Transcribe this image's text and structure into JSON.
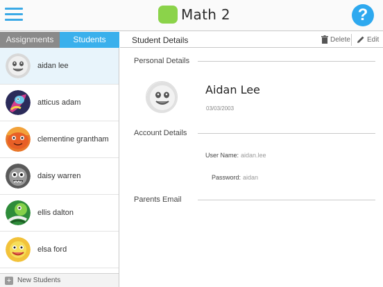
{
  "header": {
    "class_title": "Math 2",
    "badge_color": "#8bd34a",
    "help_label": "?",
    "accent": "#3aa9e6"
  },
  "tabs": [
    {
      "label": "Assignments",
      "active": false
    },
    {
      "label": "Students",
      "active": true
    }
  ],
  "students": [
    {
      "name": "aidan lee",
      "selected": true
    },
    {
      "name": "atticus adam",
      "selected": false
    },
    {
      "name": "clementine grantham",
      "selected": false
    },
    {
      "name": "daisy warren",
      "selected": false
    },
    {
      "name": "ellis dalton",
      "selected": false
    },
    {
      "name": "elsa ford",
      "selected": false
    }
  ],
  "sidebar_footer": {
    "plus": "+",
    "label": "New Students"
  },
  "detail": {
    "title": "Student Details",
    "delete_label": "Delete",
    "edit_label": "Edit",
    "personal_heading": "Personal Details",
    "student_name": "Aidan Lee",
    "date": "03/03/2003",
    "account_heading": "Account Details",
    "username_label": "User Name:",
    "username_value": "aidan.lee",
    "password_label": "Password:",
    "password_value": "aidan",
    "parents_heading": "Parents Email"
  }
}
